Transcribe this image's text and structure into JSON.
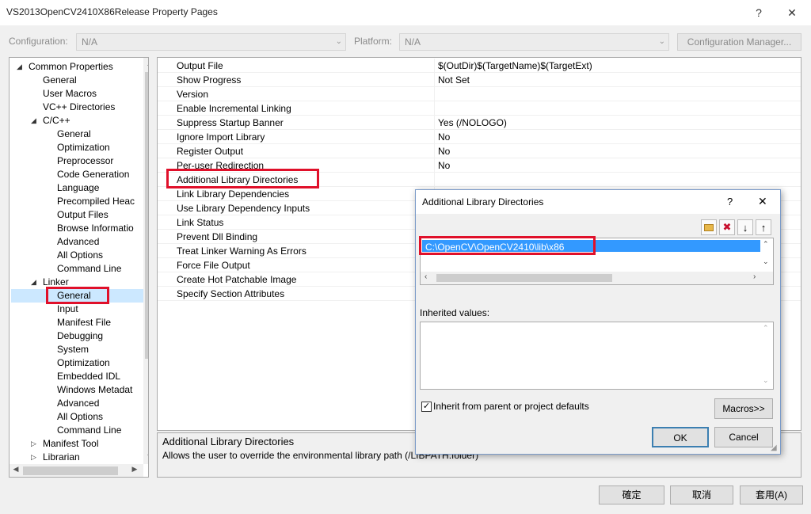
{
  "window": {
    "title": "VS2013OpenCV2410X86Release Property Pages",
    "help_glyph": "?",
    "close_glyph": "✕"
  },
  "config": {
    "configuration_label": "Configuration:",
    "configuration_value": "N/A",
    "platform_label": "Platform:",
    "platform_value": "N/A",
    "manager_label": "Configuration Manager..."
  },
  "tree": {
    "items": [
      {
        "label": "Common Properties",
        "indent": 1,
        "expander": "◢"
      },
      {
        "label": "General",
        "indent": 2
      },
      {
        "label": "User Macros",
        "indent": 2
      },
      {
        "label": "VC++ Directories",
        "indent": 2
      },
      {
        "label": "C/C++",
        "indent": 2,
        "expander": "◢"
      },
      {
        "label": "General",
        "indent": 3
      },
      {
        "label": "Optimization",
        "indent": 3
      },
      {
        "label": "Preprocessor",
        "indent": 3
      },
      {
        "label": "Code Generation",
        "indent": 3
      },
      {
        "label": "Language",
        "indent": 3
      },
      {
        "label": "Precompiled Heac",
        "indent": 3
      },
      {
        "label": "Output Files",
        "indent": 3
      },
      {
        "label": "Browse Informatio",
        "indent": 3
      },
      {
        "label": "Advanced",
        "indent": 3
      },
      {
        "label": "All Options",
        "indent": 3
      },
      {
        "label": "Command Line",
        "indent": 3
      },
      {
        "label": "Linker",
        "indent": 2,
        "expander": "◢"
      },
      {
        "label": "General",
        "indent": 3,
        "selected": true
      },
      {
        "label": "Input",
        "indent": 3
      },
      {
        "label": "Manifest File",
        "indent": 3
      },
      {
        "label": "Debugging",
        "indent": 3
      },
      {
        "label": "System",
        "indent": 3
      },
      {
        "label": "Optimization",
        "indent": 3
      },
      {
        "label": "Embedded IDL",
        "indent": 3
      },
      {
        "label": "Windows Metadat",
        "indent": 3
      },
      {
        "label": "Advanced",
        "indent": 3
      },
      {
        "label": "All Options",
        "indent": 3
      },
      {
        "label": "Command Line",
        "indent": 3
      },
      {
        "label": "Manifest Tool",
        "indent": 2,
        "expander": "▷"
      },
      {
        "label": "Librarian",
        "indent": 2,
        "expander": "▷"
      }
    ]
  },
  "properties": [
    {
      "name": "Output File",
      "value": "$(OutDir)$(TargetName)$(TargetExt)"
    },
    {
      "name": "Show Progress",
      "value": "Not Set"
    },
    {
      "name": "Version",
      "value": ""
    },
    {
      "name": "Enable Incremental Linking",
      "value": ""
    },
    {
      "name": "Suppress Startup Banner",
      "value": "Yes (/NOLOGO)"
    },
    {
      "name": "Ignore Import Library",
      "value": "No"
    },
    {
      "name": "Register Output",
      "value": "No"
    },
    {
      "name": "Per-user Redirection",
      "value": "No"
    },
    {
      "name": "Additional Library Directories",
      "value": ""
    },
    {
      "name": "Link Library Dependencies",
      "value": ""
    },
    {
      "name": "Use Library Dependency Inputs",
      "value": ""
    },
    {
      "name": "Link Status",
      "value": ""
    },
    {
      "name": "Prevent Dll Binding",
      "value": ""
    },
    {
      "name": "Treat Linker Warning As Errors",
      "value": ""
    },
    {
      "name": "Force File Output",
      "value": ""
    },
    {
      "name": "Create Hot Patchable Image",
      "value": ""
    },
    {
      "name": "Specify Section Attributes",
      "value": ""
    }
  ],
  "description": {
    "title": "Additional Library Directories",
    "text": "Allows the user to override the environmental library path (/LIBPATH:folder)"
  },
  "buttons": {
    "ok": "確定",
    "cancel": "取消",
    "apply": "套用(A)"
  },
  "dialog": {
    "title": "Additional Library Directories",
    "help_glyph": "?",
    "close_glyph": "✕",
    "directory": "C:\\OpenCV\\OpenCV2410\\lib\\x86",
    "inherited_label": "Inherited values:",
    "inherit_checkbox_label": "Inherit from parent or project defaults",
    "inherit_checked": true,
    "macros_label": "Macros>>",
    "ok_label": "OK",
    "cancel_label": "Cancel"
  },
  "colors": {
    "highlight": "#e0102a",
    "selection": "#3399ff"
  }
}
